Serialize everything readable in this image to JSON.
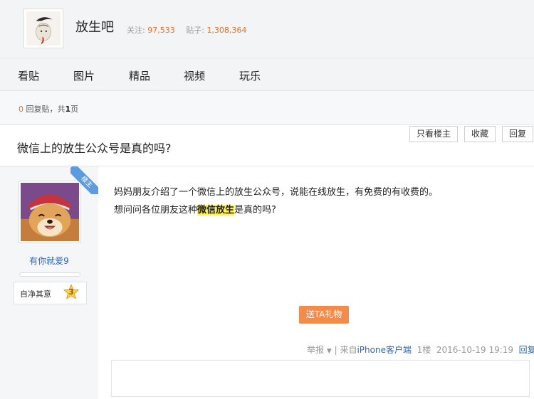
{
  "forum": {
    "name": "放生吧",
    "follow_label": "关注:",
    "follow_count": "97,533",
    "post_label": "贴子:",
    "post_count": "1,308,364"
  },
  "nav": {
    "tabs": [
      "看贴",
      "图片",
      "精品",
      "视频",
      "玩乐"
    ]
  },
  "reply_bar": {
    "count": "0",
    "text1": " 回复贴，共",
    "pages": "1",
    "text2": "页"
  },
  "thread": {
    "title": "微信上的放生公众号是真的吗?",
    "only_op_label": "只看楼主",
    "favorite_label": "收藏",
    "reply_label": "回复"
  },
  "author": {
    "badge": "楼主",
    "name": "有你就爱9",
    "level_title": "自净其意",
    "level": "3"
  },
  "post": {
    "line1": "妈妈朋友介绍了一个微信上的放生公众号，说能在线放生，有免费的有收费的。",
    "line2_before": "想问问各位朋友这种",
    "line2_highlight": "微信放生",
    "line2_after": "是真的吗?",
    "gift_label": "送TA礼物",
    "report_label": "举报",
    "from_prefix": " | 来自",
    "client": "iPhone客户端",
    "floor": "1楼",
    "time": "2016-10-19 19:19",
    "reply_label": "回复"
  },
  "colors": {
    "accent_orange": "#f36f1e",
    "link_blue": "#2d64b3",
    "highlight_yellow": "#fff35a",
    "gift_orange": "#f48b4b"
  }
}
